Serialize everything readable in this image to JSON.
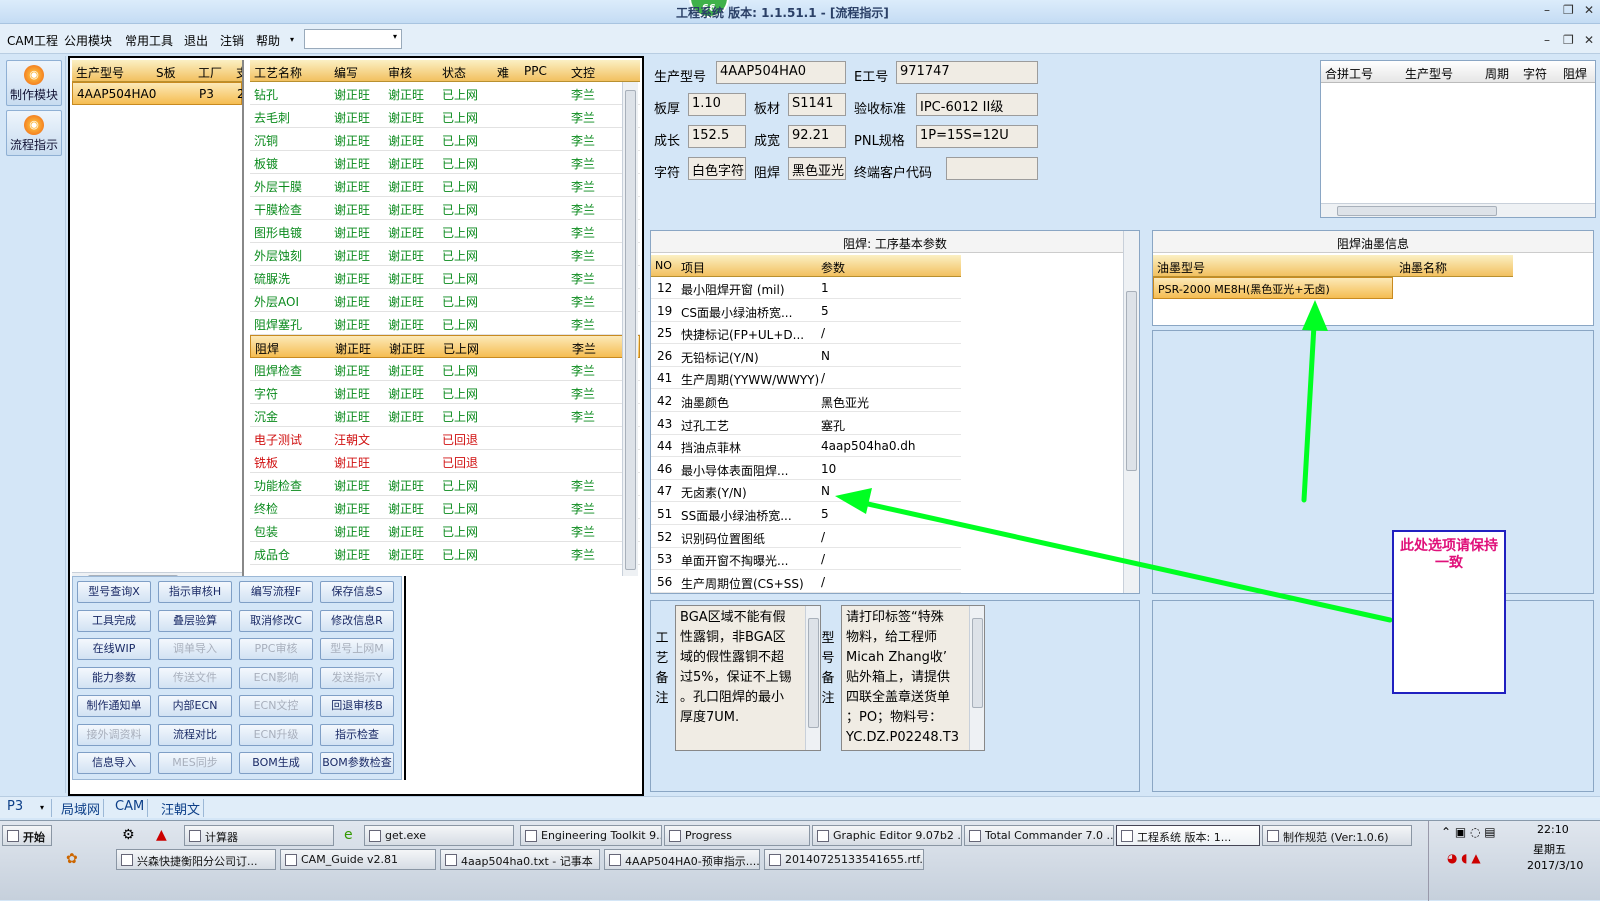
{
  "title": {
    "text": "工程系统  版本: 1.1.51.1 - [流程指示]",
    "badge": "66"
  },
  "window_controls": {
    "min": "–",
    "max": "❐",
    "close": "✕"
  },
  "menu": {
    "items": [
      "CAM工程",
      "公用模块",
      "常用工具",
      "退出",
      "注销",
      "帮助"
    ],
    "dropdown": "▾"
  },
  "rail": {
    "btn1": "制作模块",
    "btn2": "流程指示"
  },
  "model_list": {
    "headers": [
      "生产型号",
      "S板",
      "工厂",
      "支"
    ],
    "rows": [
      {
        "model": "4AAP504HA0",
        "factory": "P3",
        "tag": "2"
      }
    ]
  },
  "process": {
    "headers": [
      "工艺名称",
      "编写",
      "审核",
      "状态",
      "难",
      "PPC",
      "文控"
    ],
    "rows": [
      {
        "name": "钻孔",
        "writer": "谢正旺",
        "reviewer": "谢正旺",
        "status": "已上网",
        "doc": "李兰"
      },
      {
        "name": "去毛刺",
        "writer": "谢正旺",
        "reviewer": "谢正旺",
        "status": "已上网",
        "doc": "李兰"
      },
      {
        "name": "沉铜",
        "writer": "谢正旺",
        "reviewer": "谢正旺",
        "status": "已上网",
        "doc": "李兰"
      },
      {
        "name": "板镀",
        "writer": "谢正旺",
        "reviewer": "谢正旺",
        "status": "已上网",
        "doc": "李兰"
      },
      {
        "name": "外层干膜",
        "writer": "谢正旺",
        "reviewer": "谢正旺",
        "status": "已上网",
        "doc": "李兰"
      },
      {
        "name": "干膜检查",
        "writer": "谢正旺",
        "reviewer": "谢正旺",
        "status": "已上网",
        "doc": "李兰"
      },
      {
        "name": "图形电镀",
        "writer": "谢正旺",
        "reviewer": "谢正旺",
        "status": "已上网",
        "doc": "李兰"
      },
      {
        "name": "外层蚀刻",
        "writer": "谢正旺",
        "reviewer": "谢正旺",
        "status": "已上网",
        "doc": "李兰"
      },
      {
        "name": "硫脲洗",
        "writer": "谢正旺",
        "reviewer": "谢正旺",
        "status": "已上网",
        "doc": "李兰"
      },
      {
        "name": "外层AOI",
        "writer": "谢正旺",
        "reviewer": "谢正旺",
        "status": "已上网",
        "doc": "李兰"
      },
      {
        "name": "阻焊塞孔",
        "writer": "谢正旺",
        "reviewer": "谢正旺",
        "status": "已上网",
        "doc": "李兰"
      },
      {
        "name": "阻焊",
        "writer": "谢正旺",
        "reviewer": "谢正旺",
        "status": "已上网",
        "doc": "李兰"
      },
      {
        "name": "阻焊检查",
        "writer": "谢正旺",
        "reviewer": "谢正旺",
        "status": "已上网",
        "doc": "李兰"
      },
      {
        "name": "字符",
        "writer": "谢正旺",
        "reviewer": "谢正旺",
        "status": "已上网",
        "doc": "李兰"
      },
      {
        "name": "沉金",
        "writer": "谢正旺",
        "reviewer": "谢正旺",
        "status": "已上网",
        "doc": "李兰"
      },
      {
        "name": "电子测试",
        "writer": "汪朝文",
        "reviewer": "",
        "status": "已回退",
        "doc": ""
      },
      {
        "name": "铣板",
        "writer": "谢正旺",
        "reviewer": "",
        "status": "已回退",
        "doc": ""
      },
      {
        "name": "功能检查",
        "writer": "谢正旺",
        "reviewer": "谢正旺",
        "status": "已上网",
        "doc": "李兰"
      },
      {
        "name": "终检",
        "writer": "谢正旺",
        "reviewer": "谢正旺",
        "status": "已上网",
        "doc": "李兰"
      },
      {
        "name": "包装",
        "writer": "谢正旺",
        "reviewer": "谢正旺",
        "status": "已上网",
        "doc": "李兰"
      },
      {
        "name": "成品仓",
        "writer": "谢正旺",
        "reviewer": "谢正旺",
        "status": "已上网",
        "doc": "李兰"
      }
    ]
  },
  "buttons": [
    [
      "型号查询X",
      "指示审核H",
      "编写流程F",
      "保存信息S"
    ],
    [
      "工具完成",
      "叠层验算",
      "取消修改C",
      "修改信息R"
    ],
    [
      "在线WIP",
      "调单导入",
      "PPC审核",
      "型号上网M"
    ],
    [
      "能力参数",
      "传送文件",
      "ECN影响",
      "发送指示Y"
    ],
    [
      "制作通知单",
      "内部ECN",
      "ECN文控",
      "回退审核B"
    ],
    [
      "接外调资料",
      "流程对比",
      "ECN升级",
      "指示检查"
    ],
    [
      "信息导入",
      "MES同步",
      "BOM生成",
      "BOM参数检查"
    ]
  ],
  "info": {
    "model_label": "生产型号",
    "model": "4AAP504HA0",
    "eno_label": "E工号",
    "eno": "971747",
    "thick_label": "板厚",
    "thick": "1.10",
    "mat_label": "板材",
    "mat": "S1141",
    "std_label": "验收标准",
    "std": "IPC-6012 II级",
    "len_label": "成长",
    "len": "152.5",
    "wid_label": "成宽",
    "wid": "92.21",
    "pnl_label": "PNL规格",
    "pnl": "1P=15S=12U",
    "char_label": "字符",
    "char": "白色字符",
    "mask_label": "阻焊",
    "mask": "黑色亚光",
    "cust_label": "终端客户代码",
    "cust": ""
  },
  "merge_table": {
    "headers": [
      "合拼工号",
      "生产型号",
      "周期",
      "字符",
      "阻焊"
    ]
  },
  "params": {
    "title": "阻焊: 工序基本参数",
    "headers": [
      "NO",
      "项目",
      "参数"
    ],
    "rows": [
      {
        "no": "12",
        "item": "最小阻焊开窗 (mil)",
        "val": "1"
      },
      {
        "no": "19",
        "item": "CS面最小绿油桥宽...",
        "val": "5"
      },
      {
        "no": "25",
        "item": "快捷标记(FP+UL+D...",
        "val": "/"
      },
      {
        "no": "26",
        "item": "无铅标记(Y/N)",
        "val": "N"
      },
      {
        "no": "41",
        "item": "生产周期(YYWW/WWYY)",
        "val": "/"
      },
      {
        "no": "42",
        "item": "油墨颜色",
        "val": "黑色亚光"
      },
      {
        "no": "43",
        "item": "过孔工艺",
        "val": "塞孔"
      },
      {
        "no": "44",
        "item": "挡油点菲林",
        "val": "4aap504ha0.dh"
      },
      {
        "no": "46",
        "item": "最小导体表面阻焊...",
        "val": "10"
      },
      {
        "no": "47",
        "item": "无卤素(Y/N)",
        "val": "N"
      },
      {
        "no": "51",
        "item": "SS面最小绿油桥宽...",
        "val": "5"
      },
      {
        "no": "52",
        "item": "识别码位置图纸",
        "val": "/"
      },
      {
        "no": "53",
        "item": "单面开窗不掏曝光...",
        "val": "/"
      },
      {
        "no": "56",
        "item": "生产周期位置(CS+SS)",
        "val": "/"
      }
    ]
  },
  "ink": {
    "title": "阻焊油墨信息",
    "headers": [
      "油墨型号",
      "油墨名称"
    ],
    "rows": [
      {
        "type": "PSR-2000 ME8H(黑色亚光+无卤)",
        "name": ""
      }
    ]
  },
  "memo": {
    "craft_label": "工艺备注",
    "craft_lines": [
      "BGA区域不能有假",
      "性露铜，非BGA区",
      "域的假性露铜不超",
      "过5%，保证不上锡",
      "。孔口阻焊的最小",
      "厚度7UM."
    ],
    "model_label": "型号备注",
    "model_lines": [
      "请打印标签“特殊",
      "物料，给工程师",
      "Micah Zhang收’",
      "贴外箱上，请提供",
      "四联全盖章送货单",
      "；PO；物料号：",
      "YC.DZ.P02248.T3"
    ]
  },
  "annotation": {
    "note": "此处选项请保持一致",
    "color": "#00ff22"
  },
  "status_tabs": [
    "P3",
    "局域网",
    "CAM",
    "汪朝文"
  ],
  "taskbar": {
    "start": "开始",
    "row1": [
      "计算器",
      "get.exe",
      "Engineering Toolkit 9....",
      "Progress",
      "Graphic Editor 9.07b2 ...",
      "Total Commander 7.0 ...",
      "工程系统  版本: 1...",
      "制作规范 (Ver:1.0.6)"
    ],
    "row2": [
      "兴森快捷衡阳分公司订...",
      "CAM_Guide v2.81",
      "4aap504ha0.txt - 记事本",
      "4AAP504HA0-预审指示....",
      "20140725133541655.rtf..."
    ],
    "time": "22:10",
    "weekday": "星期五",
    "date": "2017/3/10"
  }
}
